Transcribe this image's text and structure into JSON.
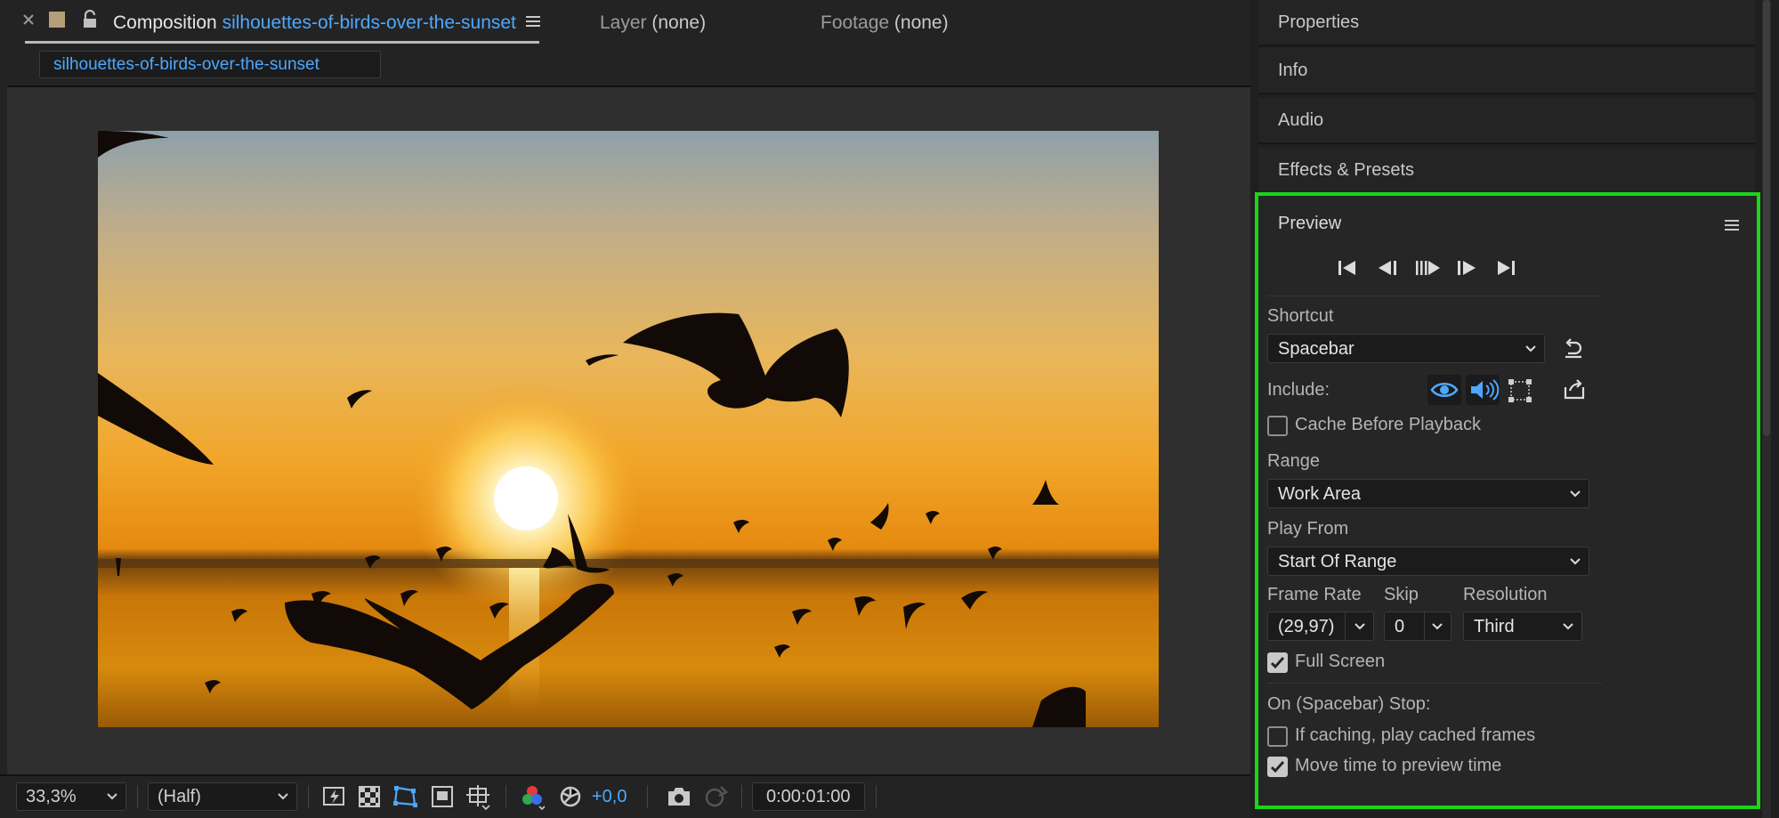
{
  "composition_panel": {
    "tab_title_prefix": "Composition",
    "tab_title_name": "silhouettes-of-birds-over-the-sunset",
    "layer_tab": {
      "prefix": "Layer",
      "value": "(none)"
    },
    "footage_tab": {
      "prefix": "Footage",
      "value": "(none)"
    },
    "comp_chip": "silhouettes-of-birds-over-the-sunset"
  },
  "viewer_toolbar": {
    "zoom": "33,3%",
    "resolution": "(Half)",
    "exposure": "+0,0",
    "timecode": "0:00:01:00"
  },
  "right_panels": {
    "properties": "Properties",
    "info": "Info",
    "audio": "Audio",
    "effects_presets": "Effects & Presets"
  },
  "preview": {
    "title": "Preview",
    "shortcut_label": "Shortcut",
    "shortcut_value": "Spacebar",
    "include_label": "Include:",
    "cache_before_playback": {
      "label": "Cache Before Playback",
      "checked": false
    },
    "range_label": "Range",
    "range_value": "Work Area",
    "play_from_label": "Play From",
    "play_from_value": "Start Of Range",
    "frame_rate_label": "Frame Rate",
    "frame_rate_value": "(29,97)",
    "skip_label": "Skip",
    "skip_value": "0",
    "resolution_label": "Resolution",
    "resolution_value": "Third",
    "full_screen": {
      "label": "Full Screen",
      "checked": true
    },
    "on_stop_label": "On (Spacebar) Stop:",
    "if_caching": {
      "label": "If caching, play cached frames",
      "checked": false
    },
    "move_time": {
      "label": "Move time to preview time",
      "checked": true
    }
  },
  "colors": {
    "accent_blue": "#4ea8ff",
    "highlight_green": "#1ad51a",
    "panel_bg": "#262626"
  }
}
